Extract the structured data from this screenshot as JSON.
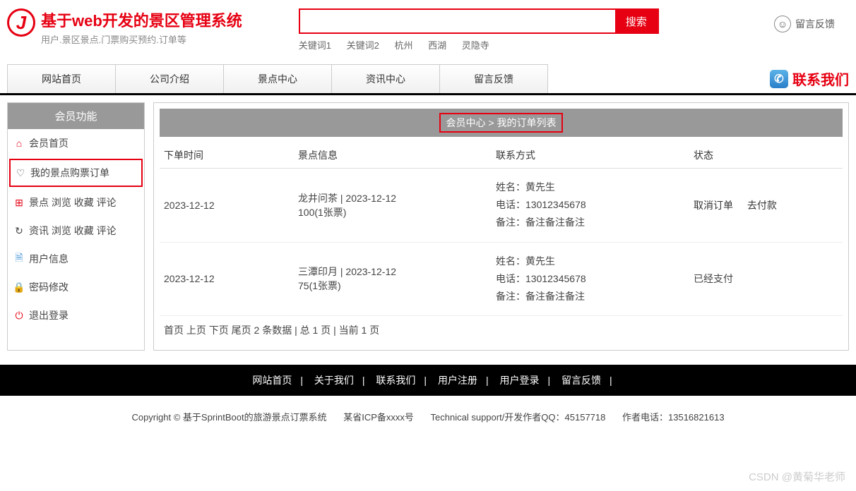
{
  "header": {
    "title": "基于web开发的景区管理系统",
    "subtitle": "用户.景区景点.门票购买预约.订单等",
    "search_placeholder": "",
    "search_btn": "搜索",
    "keywords": [
      "关键词1",
      "关键词2",
      "杭州",
      "西湖",
      "灵隐寺"
    ],
    "feedback": "留言反馈"
  },
  "nav": {
    "tabs": [
      "网站首页",
      "公司介绍",
      "景点中心",
      "资讯中心",
      "留言反馈"
    ],
    "contact": "联系我们"
  },
  "sidebar": {
    "title": "会员功能",
    "items": [
      {
        "label": "会员首页",
        "icon": "⌂"
      },
      {
        "label": "我的景点购票订单",
        "icon": "♡",
        "active": true
      },
      {
        "label": "景点 浏览 收藏 评论",
        "icon": "⊞"
      },
      {
        "label": "资讯 浏览 收藏 评论",
        "icon": "↻"
      },
      {
        "label": "用户信息",
        "icon": "🗎"
      },
      {
        "label": "密码修改",
        "icon": "🔒"
      },
      {
        "label": "退出登录",
        "icon": "⏻"
      }
    ]
  },
  "main": {
    "breadcrumb_prefix": "会员中心 > ",
    "breadcrumb_current": "我的订单列表",
    "columns": [
      "下单时间",
      "景点信息",
      "联系方式",
      "状态"
    ],
    "rows": [
      {
        "order_time": "2023-12-12",
        "spot_line1": "龙井问茶 | 2023-12-12",
        "spot_line2": "100(1张票)",
        "contact_name": "姓名：黄先生",
        "contact_phone": "电话：13012345678",
        "contact_note": "备注：备注备注备注",
        "status_actions": [
          "取消订单",
          "去付款"
        ]
      },
      {
        "order_time": "2023-12-12",
        "spot_line1": "三潭印月 | 2023-12-12",
        "spot_line2": "75(1张票)",
        "contact_name": "姓名：黄先生",
        "contact_phone": "电话：13012345678",
        "contact_note": "备注：备注备注备注",
        "status_text": "已经支付"
      }
    ],
    "pagination": "首页 上页 下页 尾页 2 条数据 | 总 1 页 | 当前 1 页"
  },
  "footer": {
    "links": [
      "网站首页",
      "关于我们",
      "联系我们",
      "用户注册",
      "用户登录",
      "留言反馈"
    ],
    "copyright": "Copyright © 基于SprintBoot的旅游景点订票系统",
    "icp": "某省ICP备xxxx号",
    "support": "Technical support/开发作者QQ：45157718",
    "phone": "作者电话：13516821613"
  },
  "watermark": "CSDN @黄菊华老师"
}
